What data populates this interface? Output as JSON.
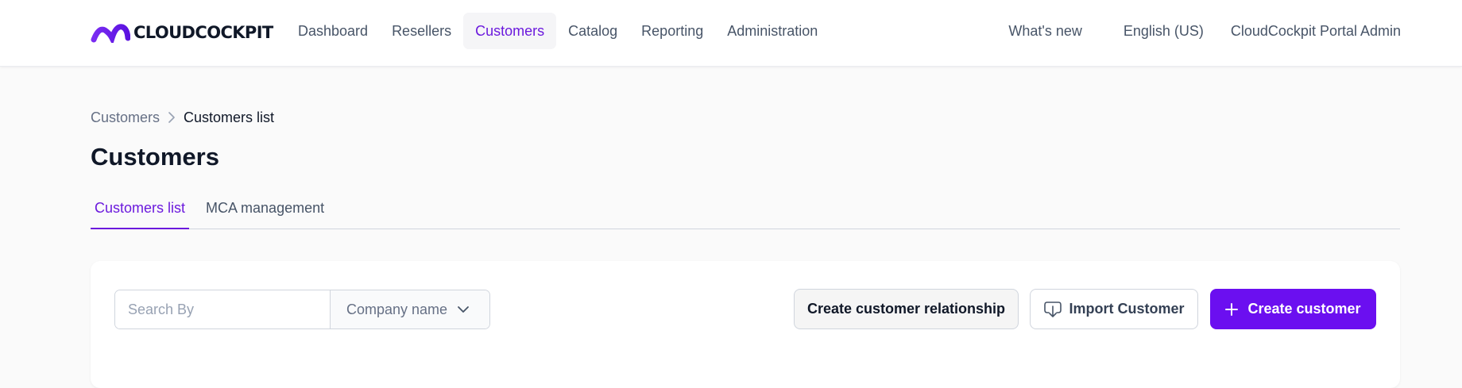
{
  "brand": {
    "name": "CLOUDCOCKPIT",
    "accent": "#6b19dd"
  },
  "nav": {
    "items": [
      {
        "label": "Dashboard"
      },
      {
        "label": "Resellers"
      },
      {
        "label": "Customers",
        "active": true
      },
      {
        "label": "Catalog"
      },
      {
        "label": "Reporting"
      },
      {
        "label": "Administration"
      }
    ],
    "whats_new": "What's new",
    "language": "English (US)",
    "user": "CloudCockpit Portal Admin"
  },
  "breadcrumb": {
    "parent": "Customers",
    "current": "Customers list",
    "separator_icon": "chevron-right-icon"
  },
  "page": {
    "title": "Customers"
  },
  "tabs": [
    {
      "label": "Customers list",
      "active": true
    },
    {
      "label": "MCA management"
    }
  ],
  "toolbar": {
    "search_placeholder": "Search By",
    "search_field": "Company name",
    "create_relationship_label": "Create customer relationship",
    "import_label": "Import Customer",
    "import_icon": "download-icon",
    "create_label": "Create customer",
    "create_icon": "plus-icon",
    "primary_color": "#6b0ff0"
  }
}
